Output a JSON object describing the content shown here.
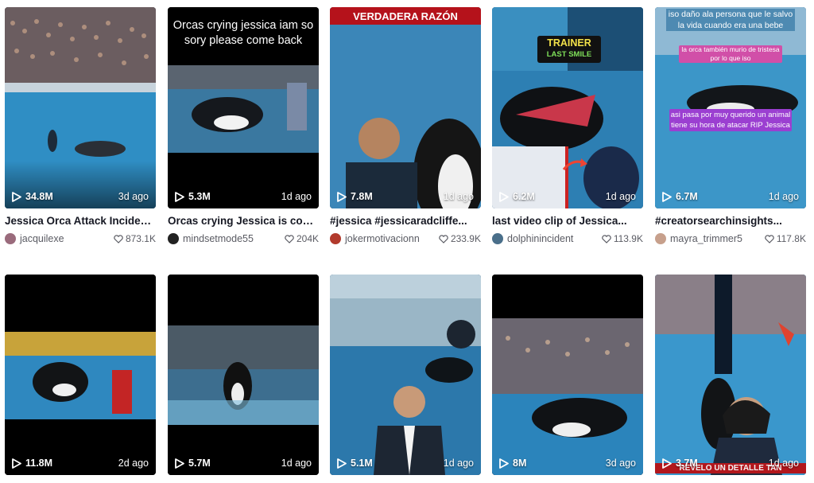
{
  "row1": [
    {
      "views": "34.8M",
      "ago": "3d ago",
      "title": "Jessica Orca Attack Incident |...",
      "author": "jacquilexe",
      "likes": "873.1K",
      "avatar_color": "#9a6b7c"
    },
    {
      "views": "5.3M",
      "ago": "1d ago",
      "title": "Orcas crying Jessica is come...",
      "author": "mindsetmode55",
      "likes": "204K",
      "avatar_color": "#222222",
      "overlay": "Orcas crying jessica iam so sory please come back"
    },
    {
      "views": "7.8M",
      "ago": "1d ago",
      "title": "#jessica #jessicaradcliffe...",
      "author": "jokermotivacionn",
      "likes": "233.9K",
      "avatar_color": "#b23a2c",
      "overlay": "VERDADERA RAZÓN"
    },
    {
      "views": "6.2M",
      "ago": "1d ago",
      "title": "last video clip of Jessica...",
      "author": "dolphinincident",
      "likes": "113.9K",
      "avatar_color": "#4a6f8a",
      "overlay_top": "TRAINER",
      "overlay_bottom": "LAST SMILE"
    },
    {
      "views": "6.7M",
      "ago": "1d ago",
      "title": "#creatorsearchinsights...",
      "author": "mayra_trimmer5",
      "likes": "117.8K",
      "avatar_color": "#c7a08c",
      "overlay_1": "iso daño ala persona que le salvo la vida cuando era una bebe",
      "overlay_2": "la orca también murio de tristesa por lo que iso",
      "overlay_3": "asi pasa por muy querido un animal tiene su hora de atacar RIP Jessica"
    }
  ],
  "row2": [
    {
      "views": "11.8M",
      "ago": "2d ago"
    },
    {
      "views": "5.7M",
      "ago": "1d ago"
    },
    {
      "views": "5.1M",
      "ago": "1d ago"
    },
    {
      "views": "8M",
      "ago": "3d ago"
    },
    {
      "views": "3.7M",
      "ago": "1d ago",
      "overlay": "REVELO UN DETALLE TAN"
    }
  ]
}
